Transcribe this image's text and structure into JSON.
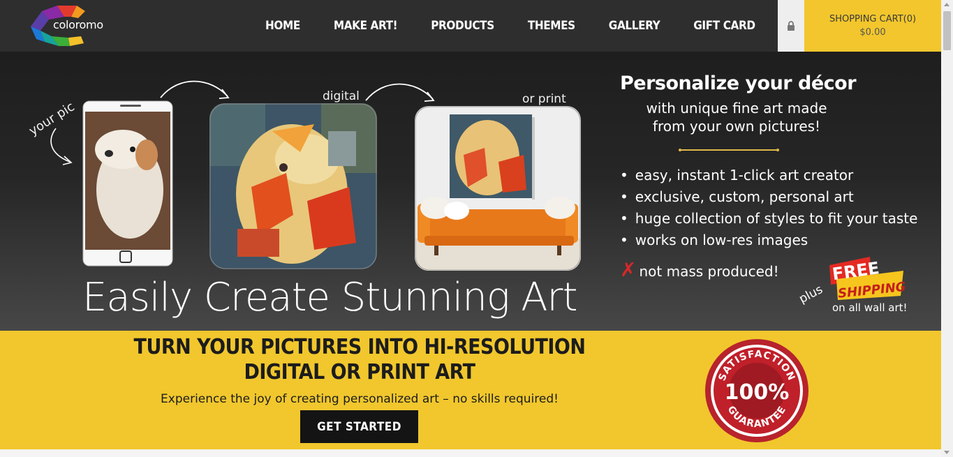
{
  "header": {
    "logo_text": "coloromo",
    "nav": [
      {
        "label": "HOME"
      },
      {
        "label": "MAKE ART!"
      },
      {
        "label": "PRODUCTS"
      },
      {
        "label": "THEMES"
      },
      {
        "label": "GALLERY"
      },
      {
        "label": "GIFT CARD"
      }
    ],
    "lock_icon": "lock-icon",
    "cart": {
      "label": "SHOPPING CART(0)",
      "total": "$0.00"
    }
  },
  "hero": {
    "your_pic": "your pic",
    "digital": "digital",
    "or_print": "or print",
    "title": "Easily Create Stunning Art",
    "personalize": {
      "title": "Personalize your décor",
      "subtitle_line1": "with unique fine art made",
      "subtitle_line2": "from your own pictures!"
    },
    "features": [
      "easy, instant 1-click art creator",
      "exclusive, custom, personal art",
      "huge collection of styles to fit your taste",
      "works on low-res images"
    ],
    "not_mass": "not mass produced!",
    "x_mark": "✗",
    "plus": "plus",
    "free": "FREE",
    "shipping": "SHIPPING",
    "on_wall": "on all wall art!"
  },
  "band": {
    "title": "TURN YOUR PICTURES INTO HI-RESOLUTION DIGITAL OR PRINT ART",
    "subtitle": "Experience the joy of creating personalized art – no skills required!",
    "button": "GET STARTED",
    "seal": {
      "top": "SATISFACTION",
      "percent": "100%",
      "bottom": "GUARANTEE"
    }
  },
  "colors": {
    "accent": "#f1c72d",
    "dark": "#2e2e2e",
    "seal_red": "#c0202a"
  }
}
